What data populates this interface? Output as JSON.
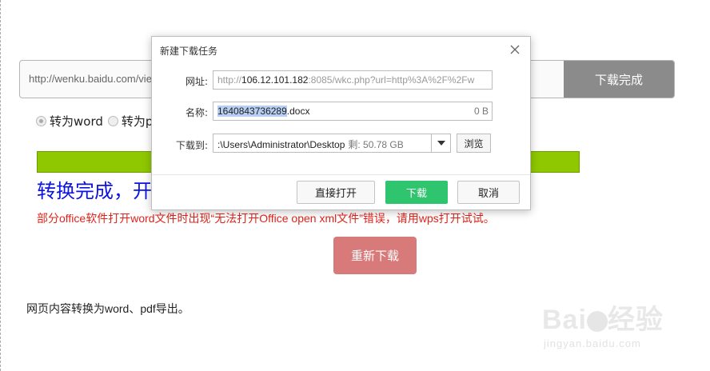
{
  "page": {
    "url_value": "http://wenku.baidu.com/view/",
    "done_button": "下载完成",
    "radio_word": "转为word",
    "radio_pdf": "转为p",
    "progress_fraction": 1.0,
    "done_text": "转换完成，开",
    "warning_text": "部分office软件打开word文件时出现“无法打开Office open xml文件”错误，请用wps打开试试。",
    "redownload_button": "重新下载",
    "bottom_text": "网页内容转换为word、pdf导出。"
  },
  "watermark": {
    "logo_left": "Bai",
    "logo_right": "经验",
    "sub": "jingyan.baidu.com"
  },
  "dialog": {
    "title": "新建下载任务",
    "url_label": "网址:",
    "url_prefix": "http://",
    "url_host": "106.12.101.182",
    "url_rest": ":8085/wkc.php?url=http%3A%2F%2Fw",
    "name_label": "名称:",
    "name_selected": "1640843736289",
    "name_ext": ".docx",
    "name_size": "0 B",
    "path_label": "下载到:",
    "path_value": ":\\Users\\Administrator\\Desktop",
    "path_free": "剩: 50.78 GB",
    "browse_button": "浏览",
    "open_button": "直接打开",
    "download_button": "下载",
    "cancel_button": "取消"
  },
  "colors": {
    "progress": "#8fc800",
    "done_text": "#0b14e0",
    "warning": "#e0241b",
    "download_button": "#2fc46e",
    "redownload_button": "#d97a7a"
  }
}
